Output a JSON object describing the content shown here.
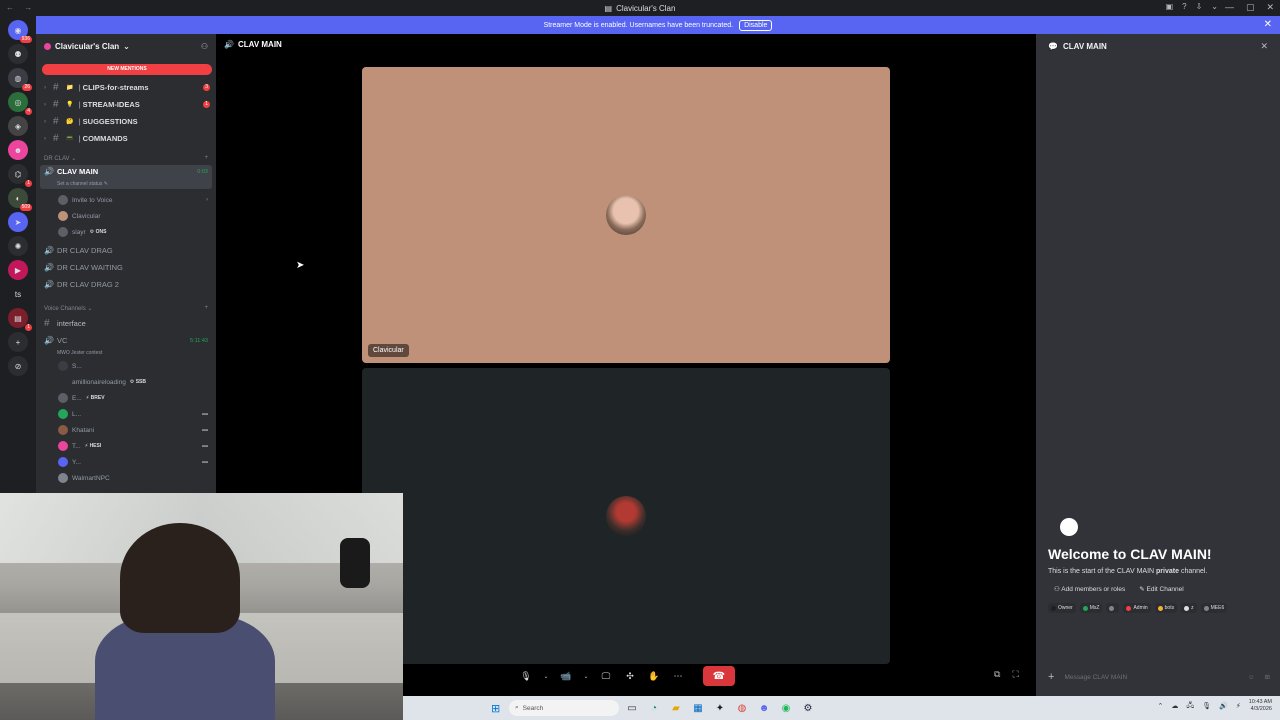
{
  "window": {
    "title": "Clavicular's Clan",
    "nav_glyphs": "← →",
    "tools": [
      "▣",
      "?",
      "⇩",
      "⌄"
    ],
    "controls": [
      "—",
      "▢",
      "✕"
    ]
  },
  "banner": {
    "message": "Streamer Mode is enabled. Usernames have been truncated.",
    "disable_label": "Disable",
    "close_glyph": "✕"
  },
  "rail": {
    "servers": [
      {
        "glyph": "◉",
        "badge": "936",
        "color": "#5865f2"
      },
      {
        "glyph": "⚉",
        "badge": "",
        "color": "#2b2d31"
      },
      {
        "glyph": "◍",
        "badge": "26",
        "color": "#3b3d44"
      },
      {
        "glyph": "◎",
        "badge": "4",
        "color": "#2b6e3c"
      },
      {
        "glyph": "◈",
        "badge": "",
        "color": "#444"
      },
      {
        "glyph": "☻",
        "badge": "",
        "color": "#eb459e"
      },
      {
        "glyph": "⌬",
        "badge": "1",
        "color": "#2b2d31"
      },
      {
        "glyph": "◐",
        "badge": "509",
        "color": "#3c4a3a"
      },
      {
        "glyph": "➤",
        "badge": "",
        "color": "#5865f2"
      },
      {
        "glyph": "✺",
        "badge": "",
        "color": "#2b2d31"
      },
      {
        "glyph": "▶",
        "badge": "",
        "color": "#c2185b"
      },
      {
        "glyph": "ts",
        "badge": "",
        "color": "#1e1f22"
      },
      {
        "glyph": "▤",
        "badge": "1",
        "color": "#7a1f2b"
      },
      {
        "glyph": "+",
        "badge": "",
        "color": "#2b2d31"
      },
      {
        "glyph": "⊘",
        "badge": "",
        "color": "#2b2d31"
      }
    ]
  },
  "server": {
    "name": "Clavicular's Clan",
    "chevron": "⌄",
    "new_mentions": "NEW MENTIONS",
    "channels": [
      {
        "emoji": "📁",
        "name": "CLIPS-for-streams",
        "badge": "3"
      },
      {
        "emoji": "💡",
        "name": "STREAM-IDEAS",
        "badge": "1"
      },
      {
        "emoji": "🤔",
        "name": "SUGGESTIONS",
        "badge": ""
      },
      {
        "emoji": "📟",
        "name": "COMMANDS",
        "badge": ""
      }
    ],
    "category_dr": "DR CLAV ⌄",
    "active_voice": {
      "name": "CLAV MAIN",
      "timer": "0:03",
      "status": "Set a channel status ✎",
      "members": [
        {
          "name": "Invite to Voice",
          "tag": "",
          "chevron": "›"
        },
        {
          "name": "Clavicular",
          "tag": ""
        },
        {
          "name": "slayr",
          "tag": "⚙ ONS"
        }
      ]
    },
    "voice_channels": [
      "DR CLAV DRAG",
      "DR CLAV WAITING",
      "DR CLAV DRAG 2"
    ],
    "category_voice": "Voice Channels ⌄",
    "text_channel": "interface",
    "vc": {
      "name": "VC",
      "timer": "5:11:43",
      "status": "MWO Jester contest",
      "members": [
        {
          "name": "S...",
          "tag": ""
        },
        {
          "name": "amillionaireloading",
          "tag": "⚙ SSB"
        },
        {
          "name": "E...",
          "tag": "⚡ BREV"
        },
        {
          "name": "L...",
          "tag": ""
        },
        {
          "name": "Khatani",
          "tag": ""
        },
        {
          "name": "T...",
          "tag": "⚡ HESI"
        },
        {
          "name": "Y...",
          "tag": ""
        },
        {
          "name": "WalmartNPC",
          "tag": ""
        }
      ]
    }
  },
  "main": {
    "header": "CLAV MAIN",
    "tiles": [
      {
        "name": "Clavicular"
      },
      {
        "name": ""
      }
    ]
  },
  "controls": {
    "mic": "🎙",
    "camera": "📹",
    "share": "🖵",
    "activities": "✣",
    "effects": "✋",
    "more": "⋯",
    "hangup": "☎",
    "popout": "⧉",
    "fullscreen": "⛶",
    "caret": "⌄"
  },
  "chat": {
    "title": "CLAV MAIN",
    "close": "✕",
    "welcome_title": "Welcome to CLAV MAIN!",
    "welcome_sub_pre": "This is the start of the CLAV MAIN ",
    "welcome_sub_bold": "private",
    "welcome_sub_post": " channel.",
    "add_members": "Add members or roles",
    "edit_channel": "Edit Channel",
    "roles": [
      {
        "name": "Owner",
        "color": "#1e1f22"
      },
      {
        "name": "MsZ",
        "color": "#23a55a"
      },
      {
        "name": "",
        "color": "#80848e"
      },
      {
        "name": "Admin",
        "color": "#f23f43"
      },
      {
        "name": "bots",
        "color": "#f0b232"
      },
      {
        "name": "z",
        "color": "#dbdee1"
      },
      {
        "name": "MEE6",
        "color": "#80848e"
      }
    ],
    "placeholder": "Message CLAV MAIN",
    "gift": "☺",
    "apps": "⊞",
    "plus": "+"
  },
  "taskbar": {
    "search": "Search",
    "time": "10:43 AM",
    "date": "4/3/2026",
    "tray": [
      "⌃",
      "☁",
      "🖧",
      "🎙",
      "🔊",
      "⚡"
    ]
  },
  "colors": {
    "accent": "#5865f2",
    "danger": "#da373c",
    "online": "#23a55a"
  }
}
